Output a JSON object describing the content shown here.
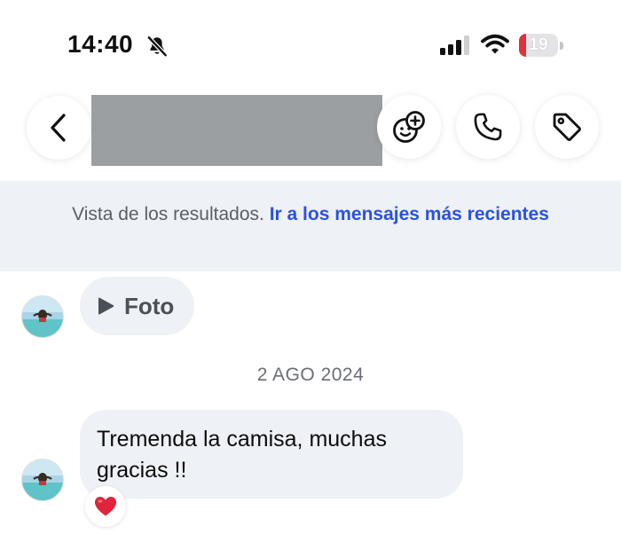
{
  "status_bar": {
    "time": "14:40",
    "battery": "19",
    "battery_fraction": 0.19,
    "icons": [
      "bell-off-icon",
      "cellular-signal-icon",
      "wifi-icon",
      "battery-icon"
    ]
  },
  "header": {
    "icons": [
      "back-arrow-icon",
      "sticker-add-icon",
      "phone-icon",
      "tag-icon"
    ]
  },
  "search_banner": {
    "text": "Vista de los resultados.",
    "link": "Ir a los mensajes más recientes"
  },
  "messages": {
    "photo_label": "Foto",
    "date_separator": "2 AGO 2024",
    "text_message": "Tremenda la camisa, muchas gracias !!",
    "reaction": "❤️"
  },
  "colors": {
    "accent_link": "#2a52e0",
    "bubble_bg": "#eef1f5",
    "battery_low": "#e0323b"
  }
}
